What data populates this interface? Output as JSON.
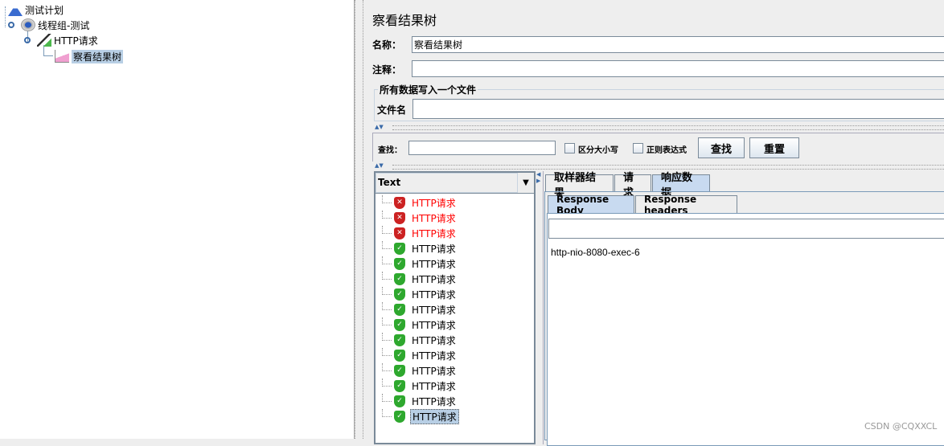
{
  "tree": {
    "nodes": [
      {
        "label": "测试计划",
        "icon": "flask-icon"
      },
      {
        "label": "线程组-测试",
        "icon": "gear-icon"
      },
      {
        "label": "HTTP请求",
        "icon": "pipette-icon"
      },
      {
        "label": "察看结果树",
        "icon": "graph-icon",
        "selected": true
      }
    ]
  },
  "panel": {
    "title": "察看结果树",
    "name_label": "名称：",
    "name_value": "察看结果树",
    "comment_label": "注释：",
    "comment_value": "",
    "file_group_title": "所有数据写入一个文件",
    "filename_label": "文件名",
    "filename_value": ""
  },
  "search": {
    "label": "查找：",
    "value": "",
    "case_label": "区分大小写",
    "regex_label": "正则表达式",
    "find_button": "查找",
    "reset_button": "重置"
  },
  "renderer": {
    "selected": "Text"
  },
  "results": [
    {
      "label": "HTTP请求",
      "status": "error"
    },
    {
      "label": "HTTP请求",
      "status": "error"
    },
    {
      "label": "HTTP请求",
      "status": "error"
    },
    {
      "label": "HTTP请求",
      "status": "success"
    },
    {
      "label": "HTTP请求",
      "status": "success"
    },
    {
      "label": "HTTP请求",
      "status": "success"
    },
    {
      "label": "HTTP请求",
      "status": "success"
    },
    {
      "label": "HTTP请求",
      "status": "success"
    },
    {
      "label": "HTTP请求",
      "status": "success"
    },
    {
      "label": "HTTP请求",
      "status": "success"
    },
    {
      "label": "HTTP请求",
      "status": "success"
    },
    {
      "label": "HTTP请求",
      "status": "success"
    },
    {
      "label": "HTTP请求",
      "status": "success"
    },
    {
      "label": "HTTP请求",
      "status": "success"
    },
    {
      "label": "HTTP请求",
      "status": "success",
      "selected": true
    }
  ],
  "tabs": [
    "取样器结果",
    "请求",
    "响应数据"
  ],
  "active_tab": "响应数据",
  "subtabs": [
    "Response Body",
    "Response headers"
  ],
  "active_subtab": "Response Body",
  "response_body": "http-nio-8080-exec-6",
  "watermark": "CSDN @CQXXCL",
  "colors": {
    "error": "#ff0000",
    "success_icon": "#2ea82e",
    "error_icon": "#cc2222",
    "selection": "#b8cfe5"
  }
}
